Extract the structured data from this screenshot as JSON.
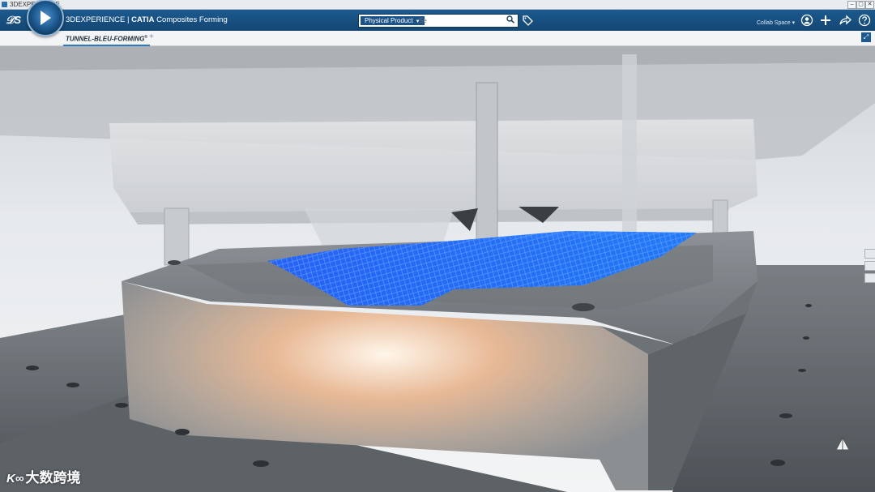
{
  "window": {
    "title": "3DEXPERIENCE",
    "controls": [
      "–",
      "▢",
      "✕"
    ]
  },
  "header": {
    "brand_prefix": "3DEXPERIENCE | ",
    "brand_bold": "CATIA",
    "app_name": " Composites Forming",
    "search": {
      "scope_label": "Physical Product",
      "placeholder": "Se",
      "value": ""
    },
    "collab_space": "Collab Space"
  },
  "tabs": [
    {
      "label": "TUNNEL-BLEU-FORMING",
      "marker": "+",
      "active": true
    }
  ],
  "icons": {
    "logo": "ds-logo-icon",
    "compass": "compass-play-icon",
    "search": "search-icon",
    "tag": "tag-icon",
    "user": "user-icon",
    "add": "add-icon",
    "share": "share-icon",
    "help": "help-icon",
    "maximize": "maximize-icon"
  },
  "watermark": {
    "mark": "K∞",
    "text": "大数跨境"
  },
  "colors": {
    "brand_blue": "#1d5a8f",
    "tab_accent": "#2f79bd",
    "ply_blue": "#1a66ff"
  }
}
